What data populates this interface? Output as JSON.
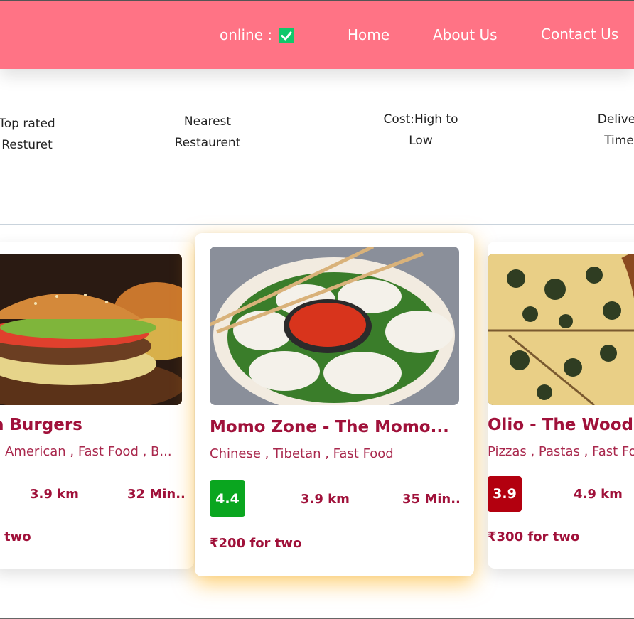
{
  "nav": {
    "online_label": "online :",
    "links": [
      "Home",
      "About Us",
      "Contact Us"
    ]
  },
  "filters": [
    [
      "Top rated",
      "Resturet"
    ],
    [
      "Nearest",
      "Restaurent"
    ],
    [
      "Cost:High to",
      "Low"
    ],
    [
      "Deliver",
      "Time"
    ]
  ],
  "cards": [
    {
      "name": "a Burgers",
      "cuisine": "American , Fast Food , B...",
      "distance": "3.9 km",
      "time": "32 Min..",
      "cost": "two",
      "image": "burger-photo"
    },
    {
      "name": "Momo Zone - The Momo...",
      "cuisine": "Chinese , Tibetan , Fast Food",
      "rating": "4.4",
      "rating_color": "#0aa61f",
      "distance": "3.9 km",
      "time": "35 Min..",
      "cost": "₹200 for two",
      "image": "momo-photo"
    },
    {
      "name": "Olio - The Wood F",
      "cuisine": "Pizzas , Pastas , Fast Fo",
      "rating": "3.9",
      "rating_color": "#b3000f",
      "distance": "4.9 km",
      "cost": "₹300 for two",
      "image": "pizza-photo"
    }
  ],
  "colors": {
    "nav_bg": "#ff7385",
    "brand_text": "#a0113a",
    "online_check": "#10c86a"
  }
}
